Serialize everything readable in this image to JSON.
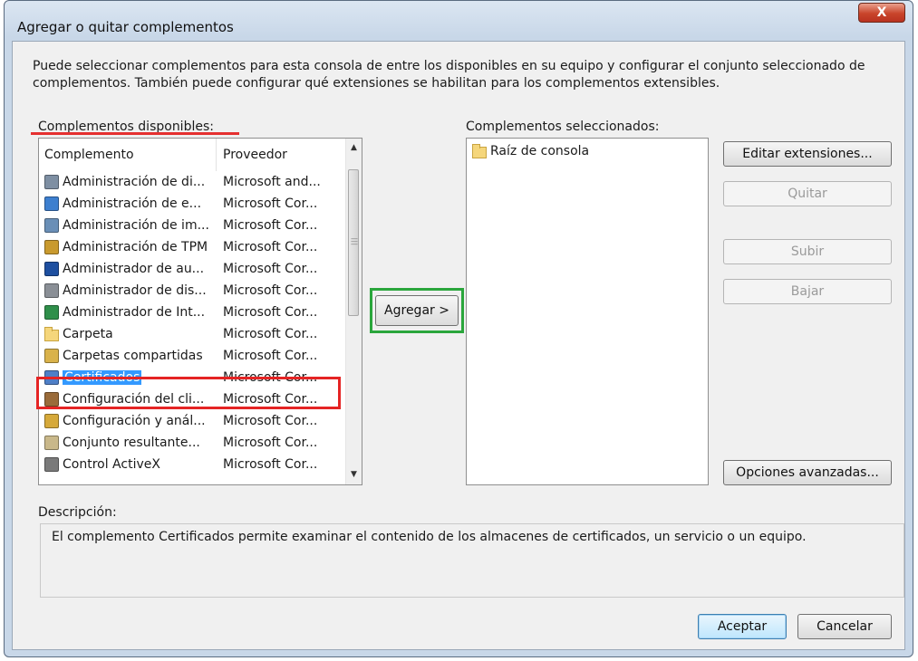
{
  "window": {
    "title": "Agregar o quitar complementos",
    "close_glyph": "X"
  },
  "intro_text": "Puede seleccionar complementos para esta consola de entre los disponibles en su equipo y configurar el conjunto seleccionado de complementos. También puede configurar qué extensiones se habilitan para los complementos extensibles.",
  "available": {
    "label": "Complementos disponibles:",
    "columns": [
      "Complemento",
      "Proveedor"
    ],
    "rows": [
      {
        "name": "Administración de di...",
        "provider": "Microsoft and...",
        "icon": "disk-management-icon"
      },
      {
        "name": "Administración de e...",
        "provider": "Microsoft Cor...",
        "icon": "computer-management-icon"
      },
      {
        "name": "Administración de im...",
        "provider": "Microsoft Cor...",
        "icon": "print-management-icon"
      },
      {
        "name": "Administración de TPM",
        "provider": "Microsoft Cor...",
        "icon": "tpm-chip-icon"
      },
      {
        "name": "Administrador de au...",
        "provider": "Microsoft Cor...",
        "icon": "authorization-manager-icon"
      },
      {
        "name": "Administrador de dis...",
        "provider": "Microsoft Cor...",
        "icon": "device-manager-icon"
      },
      {
        "name": "Administrador de Int...",
        "provider": "Microsoft Cor...",
        "icon": "internet-globe-icon"
      },
      {
        "name": "Carpeta",
        "provider": "Microsoft Cor...",
        "icon": "folder-icon"
      },
      {
        "name": "Carpetas compartidas",
        "provider": "Microsoft Cor...",
        "icon": "shared-folders-icon"
      },
      {
        "name": "Certificados",
        "provider": "Microsoft Cor...",
        "icon": "certificate-icon",
        "selected": true
      },
      {
        "name": "Configuración del cli...",
        "provider": "Microsoft Cor...",
        "icon": "client-config-icon"
      },
      {
        "name": "Configuración y anál...",
        "provider": "Microsoft Cor...",
        "icon": "security-analysis-icon"
      },
      {
        "name": "Conjunto resultante...",
        "provider": "Microsoft Cor...",
        "icon": "resultant-set-icon"
      },
      {
        "name": "Control ActiveX",
        "provider": "Microsoft Cor...",
        "icon": "activex-icon"
      }
    ]
  },
  "add_button": "Agregar >",
  "selected": {
    "label": "Complementos seleccionados:",
    "items": [
      {
        "name": "Raíz de consola",
        "icon": "folder-icon"
      }
    ]
  },
  "buttons": {
    "edit_extensions": "Editar extensiones...",
    "remove": "Quitar",
    "move_up": "Subir",
    "move_down": "Bajar",
    "advanced": "Opciones avanzadas...",
    "ok": "Aceptar",
    "cancel": "Cancelar"
  },
  "description": {
    "label": "Descripción:",
    "text": "El complemento Certificados permite examinar el contenido de los almacenes de certificados, un servicio o un equipo."
  },
  "colors": {
    "annotation_red": "#e52424",
    "annotation_green": "#2aa63c",
    "selection_blue": "#3399ff"
  }
}
